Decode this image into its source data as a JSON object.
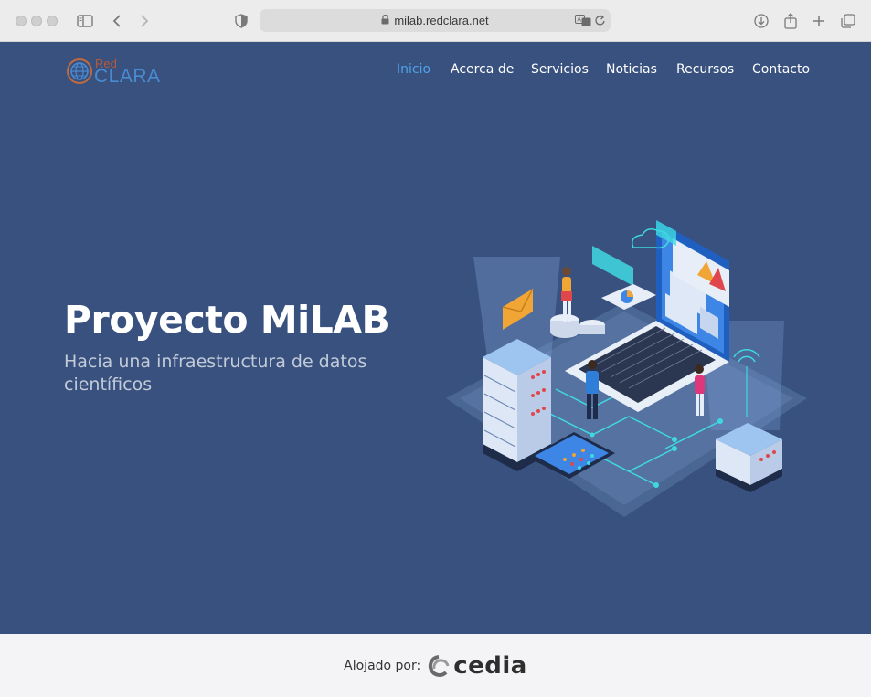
{
  "browser": {
    "url": "milab.redclara.net",
    "icons": [
      "sidebar-icon",
      "back-icon",
      "forward-icon",
      "shield-icon",
      "lock-icon",
      "translate-icon",
      "reload-icon",
      "download-icon",
      "share-icon",
      "new-tab-icon",
      "tabs-overview-icon"
    ]
  },
  "site": {
    "logo": {
      "top": "Red",
      "bottom": "CLARA"
    },
    "nav": [
      {
        "label": "Inicio",
        "active": true
      },
      {
        "label": "Acerca de",
        "active": false
      },
      {
        "label": "Servicios",
        "active": false
      },
      {
        "label": "Noticias",
        "active": false
      },
      {
        "label": "Recursos",
        "active": false
      },
      {
        "label": "Contacto",
        "active": false
      }
    ]
  },
  "hero": {
    "title": "Proyecto MiLAB",
    "subtitle": "Hacia una infraestructura de datos científicos"
  },
  "footer": {
    "label": "Alojado por:",
    "brand": "cedia"
  },
  "colors": {
    "hero_bg": "#38517f",
    "nav_active": "#4da3e8",
    "footer_bg": "#f4f4f6"
  }
}
